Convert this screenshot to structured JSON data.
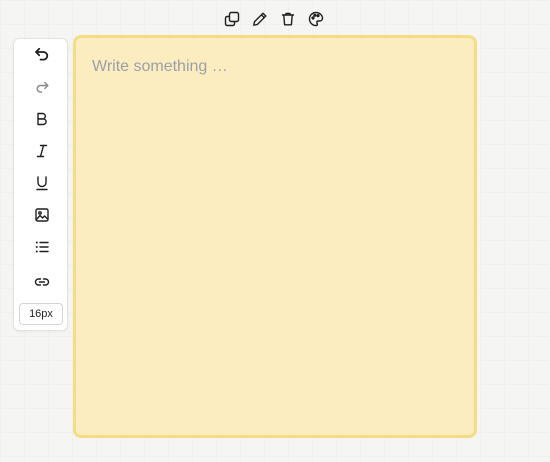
{
  "top_toolbar": {
    "icons": [
      "duplicate-icon",
      "pencil-icon",
      "trash-icon",
      "palette-icon"
    ]
  },
  "side_toolbar": {
    "buttons": [
      {
        "icon": "undo-icon",
        "enabled": true
      },
      {
        "icon": "redo-icon",
        "enabled": false
      },
      {
        "icon": "bold-icon",
        "enabled": true
      },
      {
        "icon": "italic-icon",
        "enabled": true
      },
      {
        "icon": "underline-icon",
        "enabled": true
      },
      {
        "icon": "image-icon",
        "enabled": true
      },
      {
        "icon": "bullet-list-icon",
        "enabled": true
      },
      {
        "icon": "link-icon",
        "enabled": true
      }
    ],
    "font_size": "16px"
  },
  "note": {
    "placeholder": "Write something …",
    "background_color": "#fbedc0",
    "border_color": "#f7dc86"
  }
}
